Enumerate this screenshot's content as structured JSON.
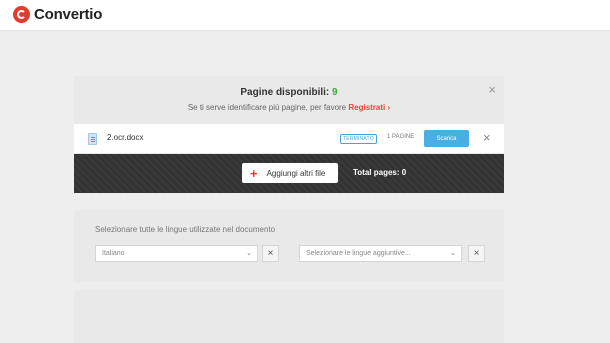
{
  "brand": {
    "name": "Convertio",
    "accent": "#e33b2e"
  },
  "banner": {
    "title_prefix": "Pagine disponibili: ",
    "title_count": "9",
    "subtitle_prefix": "Se ti serve identificare più pagine, per favore ",
    "subtitle_link": "Registrati",
    "subtitle_chevron": "›",
    "close_icon": "×"
  },
  "file": {
    "name": "2.ocr.docx",
    "status": "TERMINATO",
    "pages": "1 PAGINE",
    "download_label": "Scarica",
    "close_icon": "×"
  },
  "actions": {
    "add_files_label": "Aggiungi altri file",
    "plus_icon": "+",
    "total_pages": "Total pages: 0"
  },
  "languages": {
    "label": "Selezionare tutte le lingue utilizzate nel documento",
    "primary_value": "Italiano",
    "secondary_placeholder": "Selezionare le lingue aggiuntive...",
    "caret": "⌄",
    "clear_icon": "×"
  },
  "colors": {
    "download": "#49aee4",
    "count_green": "#3cab3c",
    "register_red": "#e5483a",
    "dark_bar": "#333333"
  }
}
